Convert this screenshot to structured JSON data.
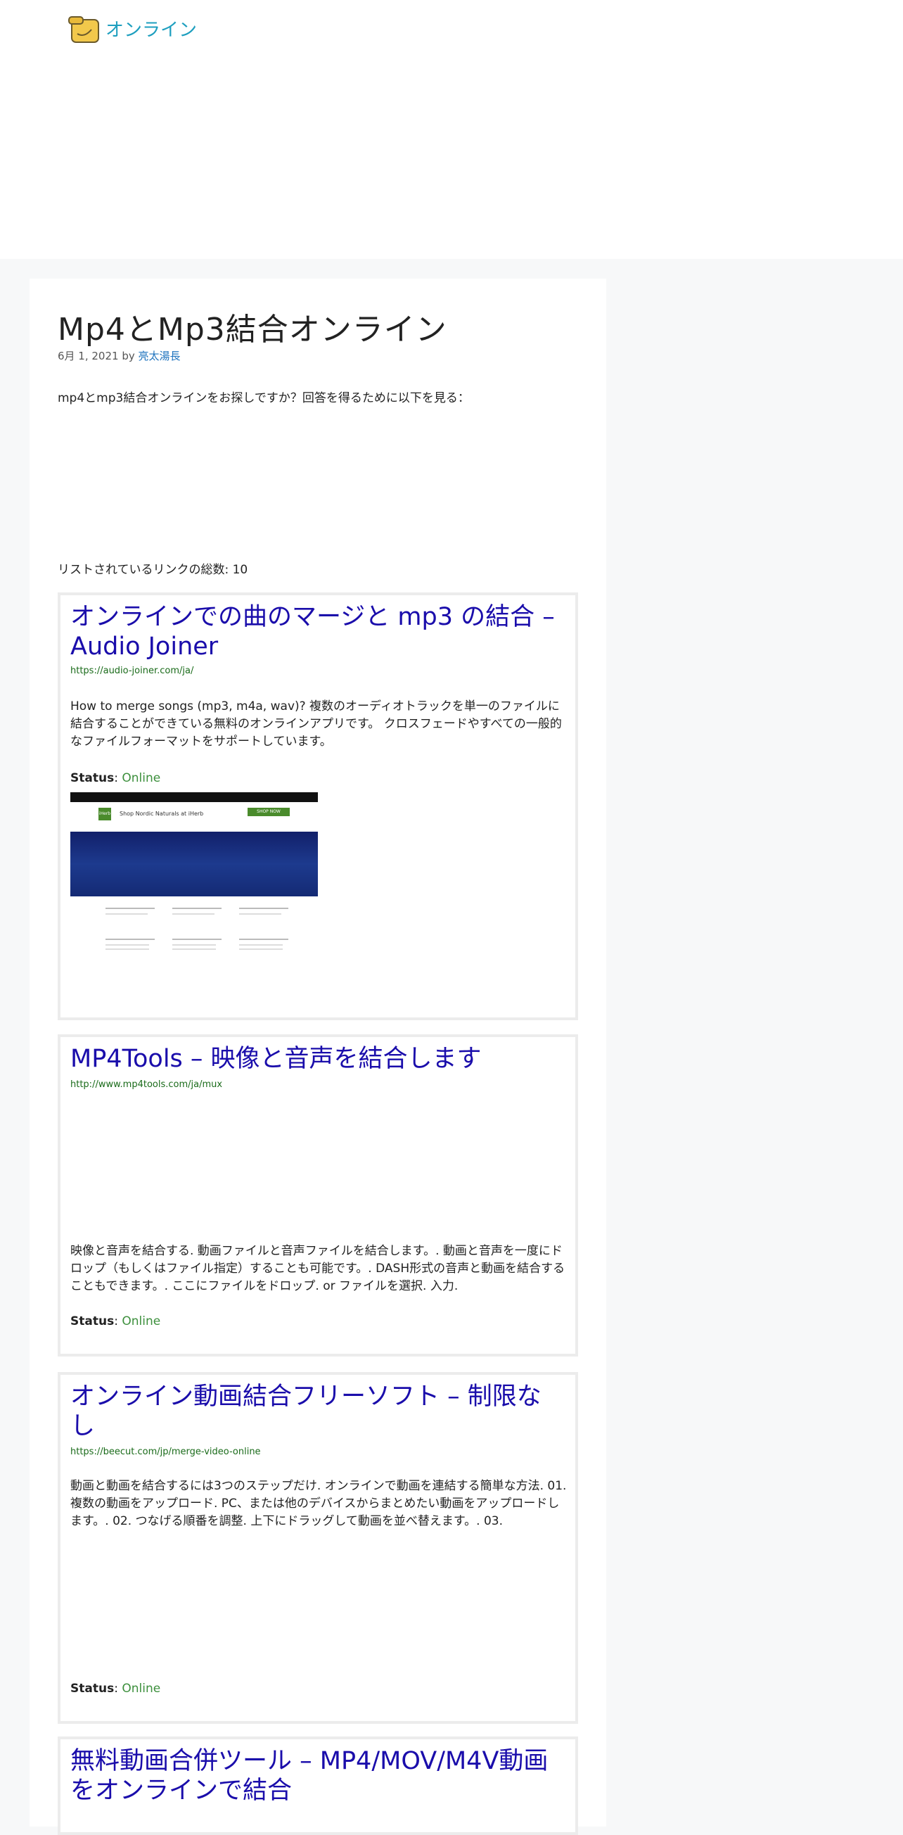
{
  "site": {
    "logo_text": "オンライン",
    "logo_icon": "folder-bird-icon"
  },
  "post": {
    "title": "Mp4とMp3結合オンライン",
    "date": "6月 1, 2021",
    "by": "by",
    "author": "亮太湯長",
    "intro": "mp4とmp3結合オンラインをお探しですか？回答を得るために以下を見る：",
    "total_links": "リストされているリンクの総数: 10"
  },
  "status_label": "Status",
  "cards": [
    {
      "title": "オンラインでの曲のマージと mp3 の結合 – Audio Joiner",
      "url": "https://audio-joiner.com/ja/",
      "desc": "How to merge songs (mp3, m4a, wav)? 複数のオーディオトラックを単一のファイルに結合することができている無料のオンラインアプリです。 クロスフェードやすべての一般的なファイルフォーマットをサポートしています。",
      "status": "Online",
      "thumb": {
        "ad_brand": "iHerb",
        "ad_text": "Shop Nordic Naturals at iHerb",
        "ad_button": "SHOP NOW"
      }
    },
    {
      "title": "MP4Tools – 映像と音声を結合します",
      "url": "http://www.mp4tools.com/ja/mux",
      "desc": "映像と音声を結合する. 動画ファイルと音声ファイルを結合します。. 動画と音声を一度にドロップ（もしくはファイル指定）することも可能です。. DASH形式の音声と動画を結合することもできます。. ここにファイルをドロップ. or ファイルを選択. 入力.",
      "status": "Online"
    },
    {
      "title": "オンライン動画結合フリーソフト – 制限なし",
      "url": "https://beecut.com/jp/merge-video-online",
      "desc": "動画と動画を結合するには3つのステップだけ. オンラインで動画を連結する簡単な方法. 01. 複数の動画をアップロード. PC、または他のデバイスからまとめたい動画をアップロードします。. 02. つなげる順番を調整. 上下にドラッグして動画を並べ替えます。. 03.",
      "status": "Online"
    },
    {
      "title": "無料動画合併ツール – MP4/MOV/M4V動画をオンラインで結合"
    }
  ]
}
